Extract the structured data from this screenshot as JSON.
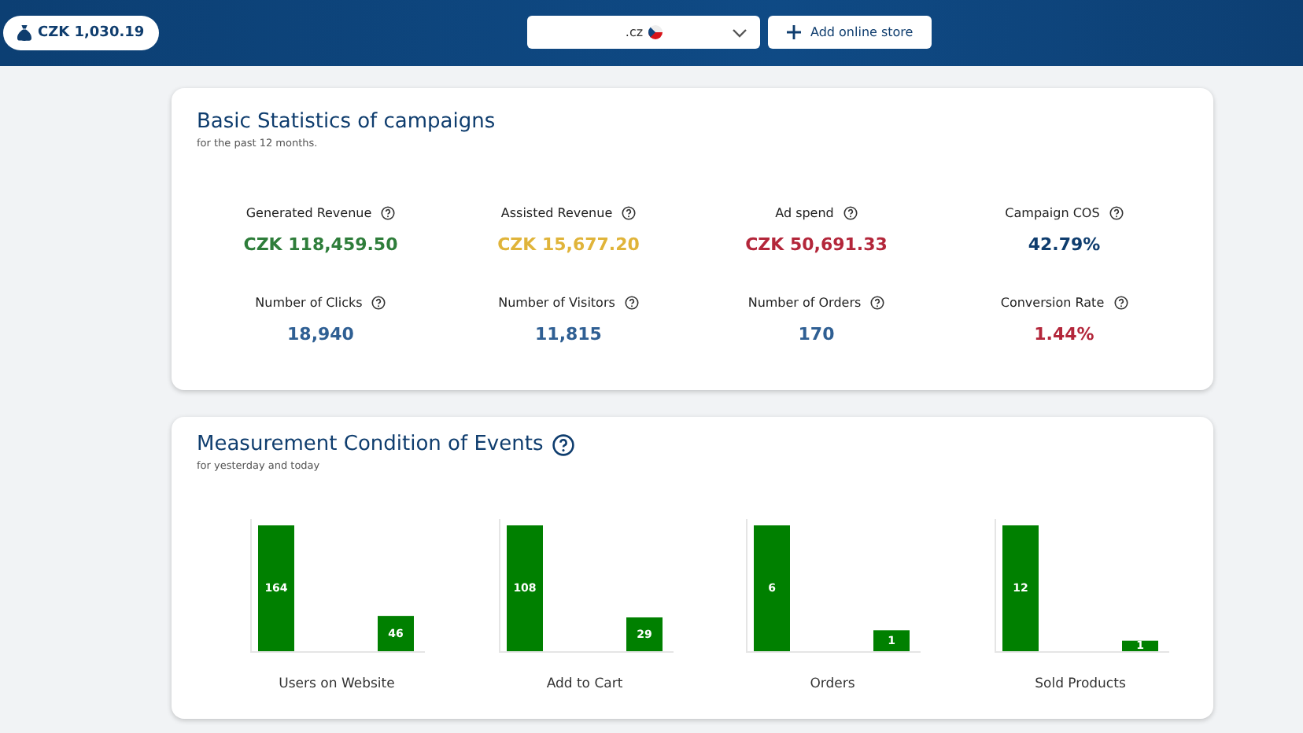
{
  "header": {
    "balance": "CZK 1,030.19",
    "store_select": {
      "value": ".cz"
    },
    "add_store_button": "Add online store"
  },
  "stats": {
    "title": "Basic Statistics of campaigns",
    "subtitle": "for the past 12 months.",
    "metrics": [
      {
        "label": "Generated Revenue",
        "value": "CZK 118,459.50",
        "color": "#2e7d3a"
      },
      {
        "label": "Assisted Revenue",
        "value": "CZK 15,677.20",
        "color": "#e0b43a"
      },
      {
        "label": "Ad spend",
        "value": "CZK 50,691.33",
        "color": "#b3263a"
      },
      {
        "label": "Campaign COS",
        "value": "42.79%",
        "color": "#0f3d6e"
      },
      {
        "label": "Number of Clicks",
        "value": "18,940",
        "color": "#2f5f93"
      },
      {
        "label": "Number of Visitors",
        "value": "11,815",
        "color": "#2f5f93"
      },
      {
        "label": "Number of Orders",
        "value": "170",
        "color": "#2f5f93"
      },
      {
        "label": "Conversion Rate",
        "value": "1.44%",
        "color": "#b3263a"
      }
    ]
  },
  "events": {
    "title": "Measurement Condition of Events",
    "subtitle": "for yesterday and today",
    "charts": [
      {
        "label": "Users on Website",
        "bars": [
          {
            "value": "164"
          },
          {
            "value": "46"
          }
        ]
      },
      {
        "label": "Add to Cart",
        "bars": [
          {
            "value": "108"
          },
          {
            "value": "29"
          }
        ]
      },
      {
        "label": "Orders",
        "bars": [
          {
            "value": "6"
          },
          {
            "value": "1"
          }
        ]
      },
      {
        "label": "Sold Products",
        "bars": [
          {
            "value": "12"
          },
          {
            "value": "1"
          }
        ]
      }
    ]
  }
}
